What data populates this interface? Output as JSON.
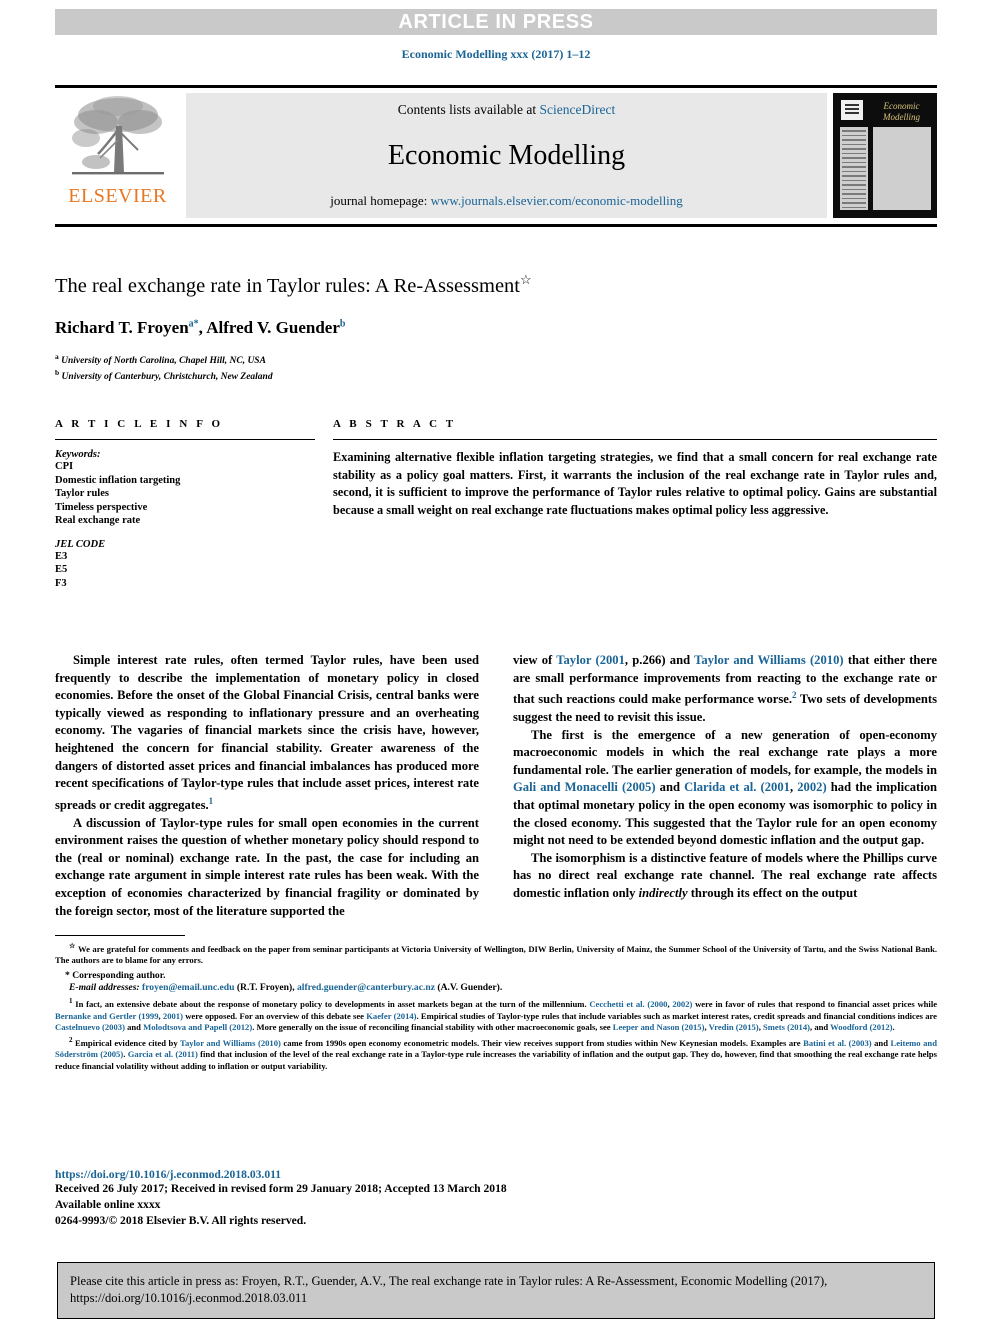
{
  "banner": {
    "text": "ARTICLE IN PRESS"
  },
  "running_head": {
    "text": "Economic Modelling xxx (2017) 1–12"
  },
  "masthead": {
    "publisher": "ELSEVIER",
    "contents_prefix": "Contents lists available at ",
    "contents_link": "ScienceDirect",
    "journal_title": "Economic Modelling",
    "homepage_prefix": "journal homepage: ",
    "homepage_link": "www.journals.elsevier.com/economic-modelling",
    "cover_title": "Economic Modelling"
  },
  "article": {
    "title": "The real exchange rate in Taylor rules: A Re-Assessment",
    "title_marker": "☆",
    "authors_1": "Richard T. Froyen",
    "authors_sup_1": "a",
    "authors_sup_1b": "*",
    "authors_2": ", Alfred V. Guender",
    "authors_sup_2": "b",
    "affiliations": [
      {
        "marker": "a",
        "text": "University of North Carolina, Chapel Hill, NC, USA"
      },
      {
        "marker": "b",
        "text": "University of Canterbury, Christchurch, New Zealand"
      }
    ]
  },
  "article_info": {
    "heading": "A R T I C L E   I N F O",
    "keywords_label": "Keywords:",
    "keywords": [
      "CPI",
      "Domestic inflation targeting",
      "Taylor rules",
      "Timeless perspective",
      "Real exchange rate"
    ],
    "jel_label": "JEL CODE",
    "jel_codes": [
      "E3",
      "E5",
      "F3"
    ]
  },
  "abstract": {
    "heading": "A B S T R A C T",
    "text": "Examining alternative flexible inflation targeting strategies, we find that a small concern for real exchange rate stability as a policy goal matters. First, it warrants the inclusion of the real exchange rate in Taylor rules and, second, it is sufficient to improve the performance of Taylor rules relative to optimal policy. Gains are substantial because a small weight on real exchange rate fluctuations makes optimal policy less aggressive."
  },
  "body": {
    "left": [
      "Simple interest rate rules, often termed Taylor rules, have been used frequently to describe the implementation of monetary policy in closed economies. Before the onset of the Global Financial Crisis, central banks were typically viewed as responding to inflationary pressure and an overheating economy. The vagaries of financial markets since the crisis have, however, heightened the concern for financial stability. Greater awareness of the dangers of distorted asset prices and financial imbalances has produced more recent specifications of Taylor-type rules that include asset prices, interest rate spreads or credit aggregates.",
      "A discussion of Taylor-type rules for small open economies in the current environment raises the question of whether monetary policy should respond to the (real or nominal) exchange rate. In the past, the case for including an exchange rate argument in simple interest rate rules has been weak. With the exception of economies characterized by financial fragility or dominated by the foreign sector, most of the literature supported the"
    ],
    "right_p1_a": "view of ",
    "right_p1_link1": "Taylor (2001",
    "right_p1_b": ", p.266) and ",
    "right_p1_link2": "Taylor and Williams (2010)",
    "right_p1_c": " that either there are small performance improvements from reacting to the exchange rate or that such reactions could make performance worse.",
    "right_p1_d": " Two sets of developments suggest the need to revisit this issue.",
    "right_p2_a": "The first is the emergence of a new generation of open-economy macroeconomic models in which the real exchange rate plays a more fundamental role. The earlier generation of models, for example, the models in ",
    "right_p2_link1": "Gali and Monacelli (2005)",
    "right_p2_b": " and ",
    "right_p2_link2": "Clarida et al. (2001",
    "right_p2_c": ", ",
    "right_p2_link3": "2002)",
    "right_p2_d": " had the implication that optimal monetary policy in the open economy was isomorphic to policy in the closed economy. This suggested that the Taylor rule for an open economy might not need to be extended beyond domestic inflation and the output gap.",
    "right_p3_a": "The isomorphism is a distinctive feature of models where the Phillips curve has no direct real exchange rate channel. The real exchange rate affects domestic inflation only ",
    "right_p3_em": "indirectly",
    "right_p3_b": " through its effect on the output",
    "sup1": "1",
    "sup2": "2"
  },
  "footnotes": {
    "star_marker": "☆",
    "star_text": "We are grateful for comments and feedback on the paper from seminar participants at Victoria University of Wellington, DIW Berlin, University of Mainz, the Summer School of the University of Tartu, and the Swiss National Bank. The authors are to blame for any errors.",
    "corresponding": "* Corresponding author.",
    "email_label": "E-mail addresses:",
    "email_1": "froyen@email.unc.edu",
    "email_1_name": " (R.T. Froyen), ",
    "email_2": "alfred.guender@canterbury.ac.nz",
    "email_2_name": " (A.V. Guender).",
    "fn1_marker": "1",
    "fn1_a": "In fact, an extensive debate about the response of monetary policy to developments in asset markets began at the turn of the millennium. ",
    "fn1_l1": "Cecchetti et al. (2000",
    "fn1_b": ", ",
    "fn1_l2": "2002)",
    "fn1_c": " were in favor of rules that respond to financial asset prices while ",
    "fn1_l3": "Bernanke and Gertler (1999",
    "fn1_d": ", ",
    "fn1_l4": "2001)",
    "fn1_e": " were opposed. For an overview of this debate see ",
    "fn1_l5": "Kaefer (2014)",
    "fn1_f": ". Empirical studies of Taylor-type rules that include variables such as market interest rates, credit spreads and financial conditions indices are ",
    "fn1_l6": "Castelnuevo (2003)",
    "fn1_g": " and ",
    "fn1_l7": "Molodtsova and Papell (2012)",
    "fn1_h": ". More generally on the issue of reconciling financial stability with other macroeconomic goals, see ",
    "fn1_l8": "Leeper and Nason (2015)",
    "fn1_i": ", ",
    "fn1_l9": "Vredin (2015)",
    "fn1_j": ", ",
    "fn1_l10": "Smets (2014)",
    "fn1_k": ", and ",
    "fn1_l11": "Woodford (2012)",
    "fn1_l": ".",
    "fn2_marker": "2",
    "fn2_a": "Empirical evidence cited by ",
    "fn2_l1": "Taylor and Williams (2010)",
    "fn2_b": " came from 1990s open economy econometric models. Their view receives support from studies within New Keynesian models. Examples are ",
    "fn2_l2": "Batini et al. (2003)",
    "fn2_c": " and ",
    "fn2_l3": "Leitemo and Söderström (2005)",
    "fn2_d": ". ",
    "fn2_l4": "Garcia et al. (2011)",
    "fn2_e": " find that inclusion of the level of the real exchange rate in a Taylor-type rule increases the variability of inflation and the output gap. They do, however, find that smoothing the real exchange rate helps reduce financial volatility without adding to inflation or output variability."
  },
  "doi_block": {
    "doi_url": "https://doi.org/10.1016/j.econmod.2018.03.011",
    "dates": "Received 26 July 2017; Received in revised form 29 January 2018; Accepted 13 March 2018",
    "available": "Available online xxxx",
    "copyright": "0264-9993/© 2018 Elsevier B.V. All rights reserved."
  },
  "cite_box": {
    "line1": "Please cite this article in press as: Froyen, R.T., Guender, A.V., The real exchange rate in Taylor rules: A Re-Assessment, Economic Modelling (2017),",
    "line2": "https://doi.org/10.1016/j.econmod.2018.03.011"
  },
  "colors": {
    "link": "#1a6496",
    "banner_bg": "#c9c9c9",
    "masthead_bg": "#e8e8e8",
    "elsevier_orange": "#E87722"
  }
}
